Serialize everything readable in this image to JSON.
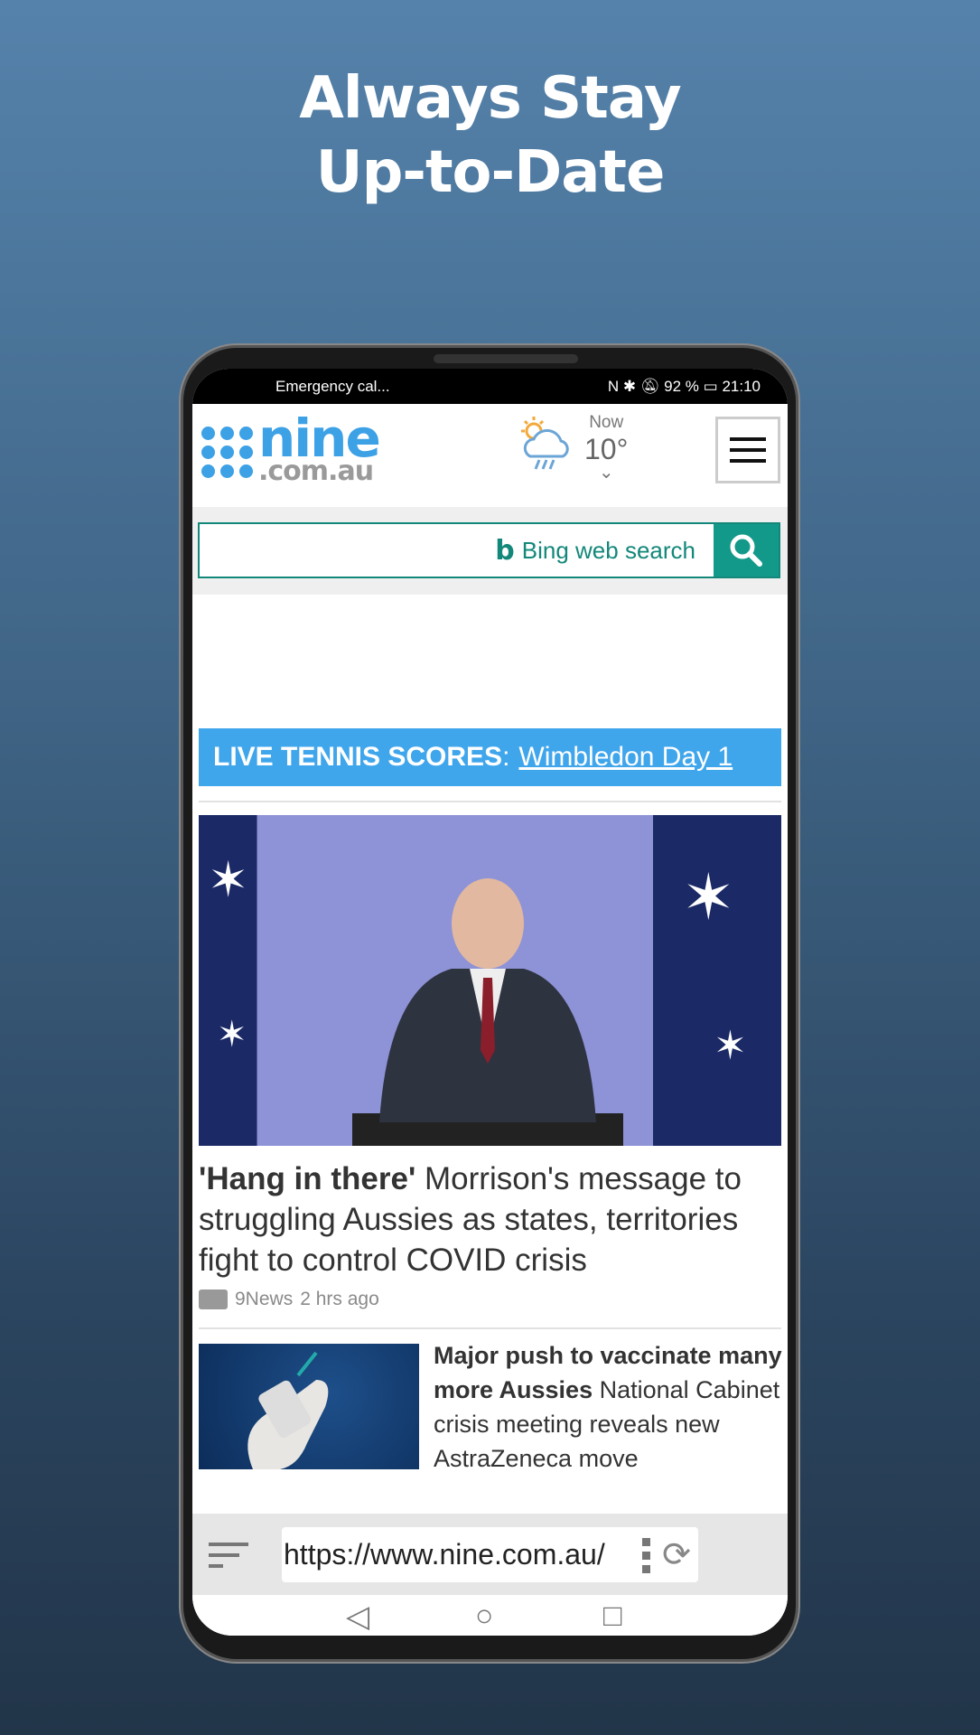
{
  "promo": {
    "line1": "Always Stay",
    "line2": "Up-to-Date"
  },
  "status": {
    "carrier": "Emergency cal...",
    "battery": "92 %",
    "time": "21:10"
  },
  "header": {
    "logo_main": "nine",
    "logo_sub": ".com.au",
    "weather_label": "Now",
    "weather_temp": "10°",
    "weather_icon": "rain-cloud-sun-icon"
  },
  "search": {
    "placeholder": "Bing web search"
  },
  "banner": {
    "label": "LIVE TENNIS SCORES",
    "sep": ":",
    "link": "Wimbledon Day 1",
    "color": "#40a6ec"
  },
  "stories": [
    {
      "headline_bold": "'Hang in there'",
      "headline": " Morrison's message to struggling Aussies as states, territories fight to control COVID crisis",
      "source": "9News",
      "time": "2 hrs ago"
    },
    {
      "headline_bold": "Major push to vaccinate many more Aussies",
      "headline": " National Cabinet crisis meeting reveals new AstraZeneca move"
    }
  ],
  "browser": {
    "url": "https://www.nine.com.au/"
  },
  "colors": {
    "accent": "#13998a",
    "brand": "#3da1e6"
  }
}
